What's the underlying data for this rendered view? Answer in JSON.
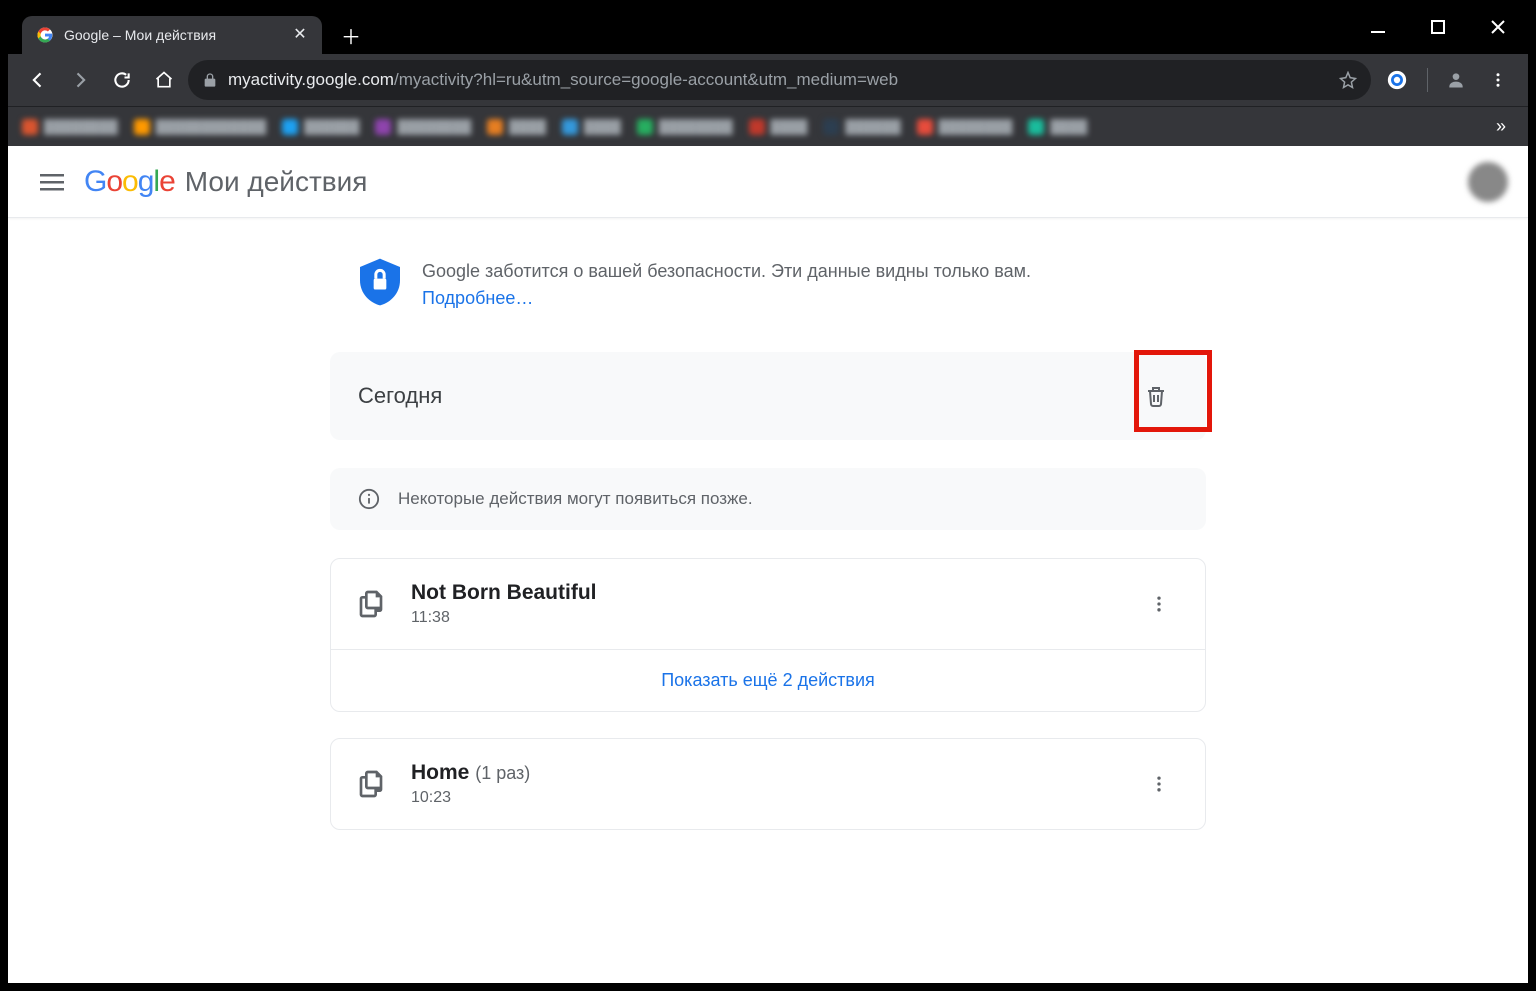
{
  "browser": {
    "tab_title": "Google – Мои действия",
    "url_host": "myactivity.google.com",
    "url_path": "/myactivity?hl=ru&utm_source=google-account&utm_medium=web"
  },
  "header": {
    "product": "Мои действия"
  },
  "privacy": {
    "text": "Google заботится о вашей безопасности. Эти данные видны только вам.",
    "link": "Подробнее…"
  },
  "day": {
    "label": "Сегодня"
  },
  "info": {
    "text": "Некоторые действия могут появиться позже."
  },
  "activities": [
    {
      "title": "Not Born Beautiful",
      "count": "",
      "time": "11:38",
      "show_more": "Показать ещё 2 действия"
    },
    {
      "title": "Home",
      "count": "(1 раз)",
      "time": "10:23",
      "show_more": ""
    }
  ]
}
